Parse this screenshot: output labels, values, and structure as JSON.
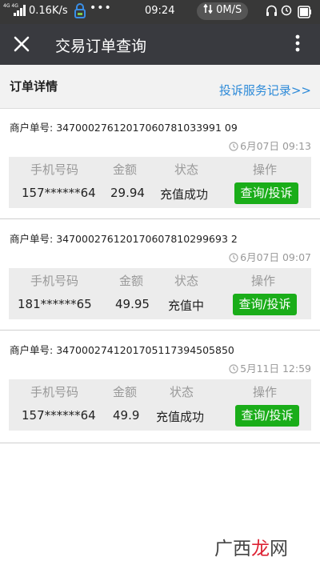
{
  "status_bar": {
    "network_label": "4G 4G",
    "speed": "0.16K/s",
    "dots": "•••",
    "time": "09:24",
    "net_speed": "0M/S",
    "battery_icon": "battery-icon"
  },
  "header": {
    "title": "交易订单查询",
    "close_icon": "close-icon",
    "more_icon": "more-icon"
  },
  "details": {
    "title": "订单详情",
    "complaint_link": "投诉服务记录>>"
  },
  "labels": {
    "merchant_prefix": "商户单号: ",
    "col_phone": "手机号码",
    "col_amount": "金额",
    "col_status": "状态",
    "col_action": "操作",
    "action_button": "查询/投诉"
  },
  "orders": [
    {
      "merchant_no": "34700027612017060781033991 09",
      "date": "6月07日 09:13",
      "phone": "157******64",
      "amount": "29.94",
      "status": "充值成功"
    },
    {
      "merchant_no": "347000276120170607810299693 2",
      "date": "6月07日 09:07",
      "phone": "181******65",
      "amount": "49.95",
      "status": "充值中"
    },
    {
      "merchant_no": "3470002741201705117394505850",
      "date": "5月11日 12:59",
      "phone": "157******64",
      "amount": "49.9",
      "status": "充值成功"
    }
  ],
  "watermark": "广西龙网",
  "colors": {
    "status_bar": "#383838",
    "title_bar": "#393a3f",
    "link": "#2d8ad8",
    "button": "#1aad19",
    "table_bg": "#ececec"
  }
}
